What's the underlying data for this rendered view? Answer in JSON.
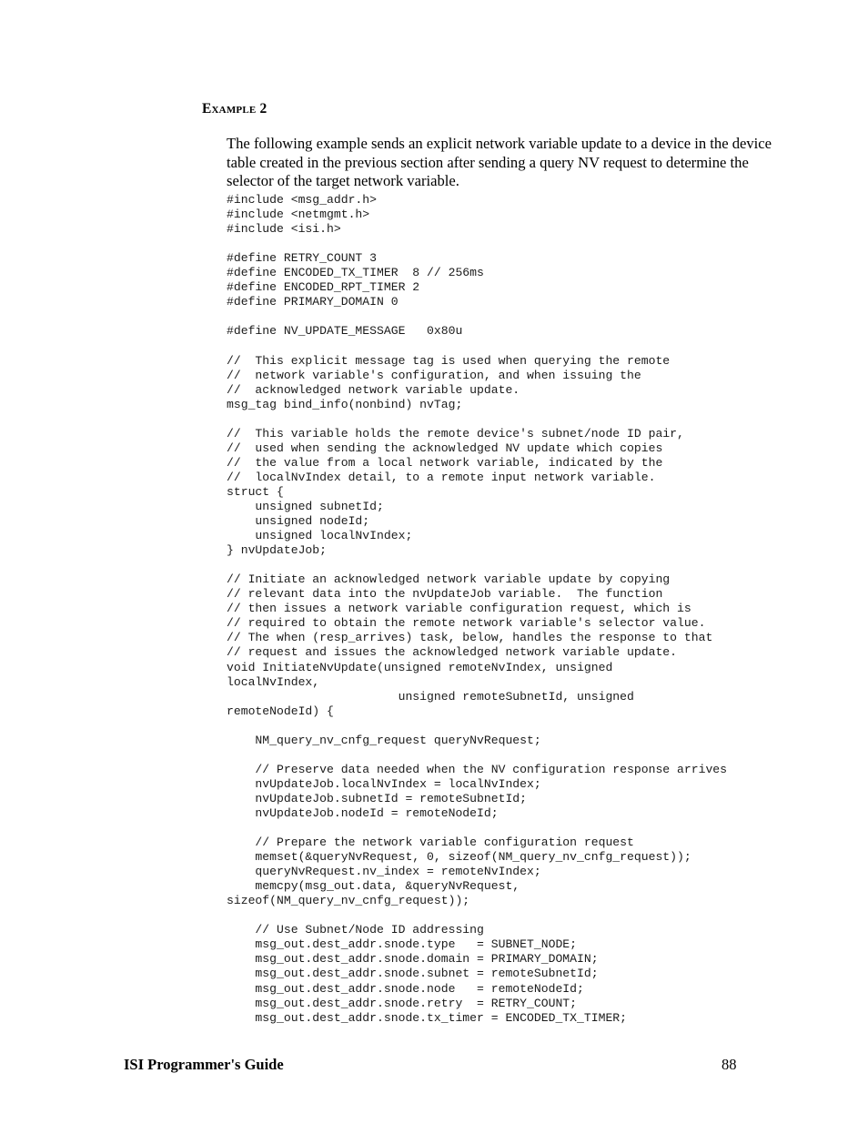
{
  "document": {
    "section_heading": "Example 2",
    "intro_paragraph": "The following example sends an explicit network variable update to a device in the device table created in the previous section after sending a query NV request to determine the selector of the target network variable."
  },
  "code": {
    "lines": [
      "#include <msg_addr.h>",
      "#include <netmgmt.h>",
      "#include <isi.h>",
      "",
      "#define RETRY_COUNT 3",
      "#define ENCODED_TX_TIMER  8 // 256ms",
      "#define ENCODED_RPT_TIMER 2",
      "#define PRIMARY_DOMAIN 0",
      "",
      "#define NV_UPDATE_MESSAGE   0x80u",
      "",
      "//  This explicit message tag is used when querying the remote",
      "//  network variable's configuration, and when issuing the",
      "//  acknowledged network variable update.",
      "msg_tag bind_info(nonbind) nvTag;",
      "",
      "//  This variable holds the remote device's subnet/node ID pair,",
      "//  used when sending the acknowledged NV update which copies",
      "//  the value from a local network variable, indicated by the",
      "//  localNvIndex detail, to a remote input network variable.",
      "struct {",
      "    unsigned subnetId;",
      "    unsigned nodeId;",
      "    unsigned localNvIndex;",
      "} nvUpdateJob;",
      "",
      "// Initiate an acknowledged network variable update by copying",
      "// relevant data into the nvUpdateJob variable.  The function",
      "// then issues a network variable configuration request, which is",
      "// required to obtain the remote network variable's selector value.",
      "// The when (resp_arrives) task, below, handles the response to that",
      "// request and issues the acknowledged network variable update.",
      "void InitiateNvUpdate(unsigned remoteNvIndex, unsigned",
      "localNvIndex,",
      "                        unsigned remoteSubnetId, unsigned",
      "remoteNodeId) {",
      "",
      "    NM_query_nv_cnfg_request queryNvRequest;",
      "",
      "    // Preserve data needed when the NV configuration response arrives",
      "    nvUpdateJob.localNvIndex = localNvIndex;",
      "    nvUpdateJob.subnetId = remoteSubnetId;",
      "    nvUpdateJob.nodeId = remoteNodeId;",
      "",
      "    // Prepare the network variable configuration request",
      "    memset(&queryNvRequest, 0, sizeof(NM_query_nv_cnfg_request));",
      "    queryNvRequest.nv_index = remoteNvIndex;",
      "    memcpy(msg_out.data, &queryNvRequest,",
      "sizeof(NM_query_nv_cnfg_request));",
      "",
      "    // Use Subnet/Node ID addressing",
      "    msg_out.dest_addr.snode.type   = SUBNET_NODE;",
      "    msg_out.dest_addr.snode.domain = PRIMARY_DOMAIN;",
      "    msg_out.dest_addr.snode.subnet = remoteSubnetId;",
      "    msg_out.dest_addr.snode.node   = remoteNodeId;",
      "    msg_out.dest_addr.snode.retry  = RETRY_COUNT;",
      "    msg_out.dest_addr.snode.tx_timer = ENCODED_TX_TIMER;"
    ]
  },
  "footer": {
    "title": "ISI Programmer's Guide",
    "page_number": "88"
  }
}
